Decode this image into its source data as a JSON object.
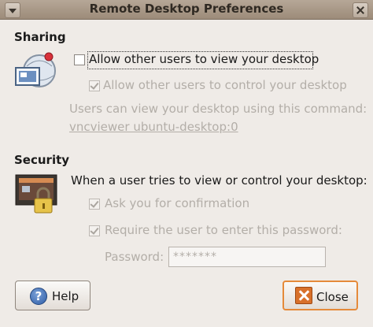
{
  "window": {
    "title": "Remote Desktop Preferences"
  },
  "sharing": {
    "heading": "Sharing",
    "icon": "remote-desktop-icon",
    "allow_view": {
      "label": "Allow other users to view your desktop",
      "checked": false
    },
    "allow_control": {
      "label": "Allow other users to control your desktop",
      "checked": true,
      "enabled": false
    },
    "command_info": "Users can view your desktop using this command:",
    "command": "vncviewer ubuntu-desktop:0"
  },
  "security": {
    "heading": "Security",
    "icon": "lock-screen-icon",
    "prompt": "When a user tries to view or control your desktop:",
    "ask_confirmation": {
      "label": "Ask you for confirmation",
      "checked": true,
      "enabled": false
    },
    "require_password": {
      "label": "Require the user to enter this password:",
      "checked": true,
      "enabled": false
    },
    "password_label": "Password:",
    "password_value": "*******"
  },
  "buttons": {
    "help": {
      "label": "Help",
      "icon": "help-icon"
    },
    "close": {
      "label": "Close",
      "icon": "close-icon"
    }
  },
  "colors": {
    "focus_accent": "#e58a3a",
    "disabled_text": "#b3aea8"
  }
}
